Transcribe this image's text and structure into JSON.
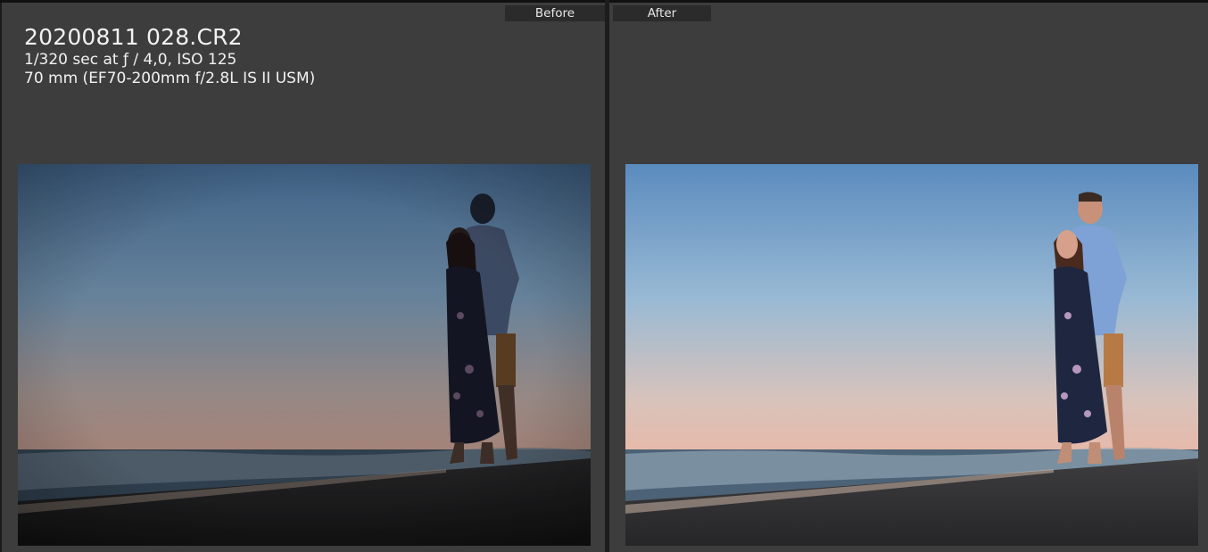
{
  "compare": {
    "before_label": "Before",
    "after_label": "After"
  },
  "photo_info": {
    "filename": "20200811 028.CR2",
    "exposure": "1/320 sec at ƒ / 4,0, ISO 125",
    "lens": "70 mm (EF70-200mm f/2.8L IS II USM)"
  },
  "colors": {
    "panel_bg": "#3d3d3d",
    "label_bg": "#2b2b2b",
    "text": "#f2f2f2"
  }
}
